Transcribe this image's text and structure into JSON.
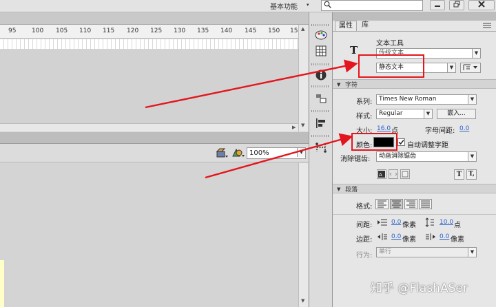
{
  "topbar": {
    "workspace": "基本功能",
    "ws_arrow": "▾"
  },
  "timeline": {
    "ticks": [
      "95",
      "100",
      "105",
      "110",
      "115",
      "120",
      "125",
      "130",
      "135",
      "140",
      "145",
      "150",
      "155"
    ]
  },
  "stage": {
    "zoom": "100%"
  },
  "panel": {
    "tab_properties": "属性",
    "tab_library": "库",
    "tool_name": "文本工具",
    "tool_glyph": "T",
    "text_engine": "传统文本",
    "text_type": "静态文本",
    "section_character": "字符",
    "family_label": "系列:",
    "family_value": "Times New Roman",
    "style_label": "样式:",
    "style_value": "Regular",
    "embed_label": "嵌入...",
    "size_label": "大小:",
    "size_value": "16.0",
    "size_unit": "点",
    "spacing_label": "字母间距:",
    "spacing_value": "0.0",
    "color_label": "颜色:",
    "color_swatch": "#000000",
    "auto_kern_label": "自动调整字距",
    "aa_label": "消除锯齿:",
    "aa_value": "动画消除锯齿",
    "sup_icon": "T",
    "sub_icon": "T,",
    "section_paragraph": "段落",
    "format_label": "格式:",
    "spacing_row_label": "间距:",
    "indent_value": "0.0",
    "px_unit": "像素",
    "line_spacing_value": "10.0",
    "line_unit": "点",
    "margin_label": "边距:",
    "margin_left_value": "0.0",
    "margin_right_value": "0.0",
    "behavior_label": "行为:",
    "behavior_value": "单行"
  },
  "watermark": "知乎 @FlashASer",
  "colors": {
    "annotation": "#e3161e",
    "accent": "#2a62c9"
  }
}
